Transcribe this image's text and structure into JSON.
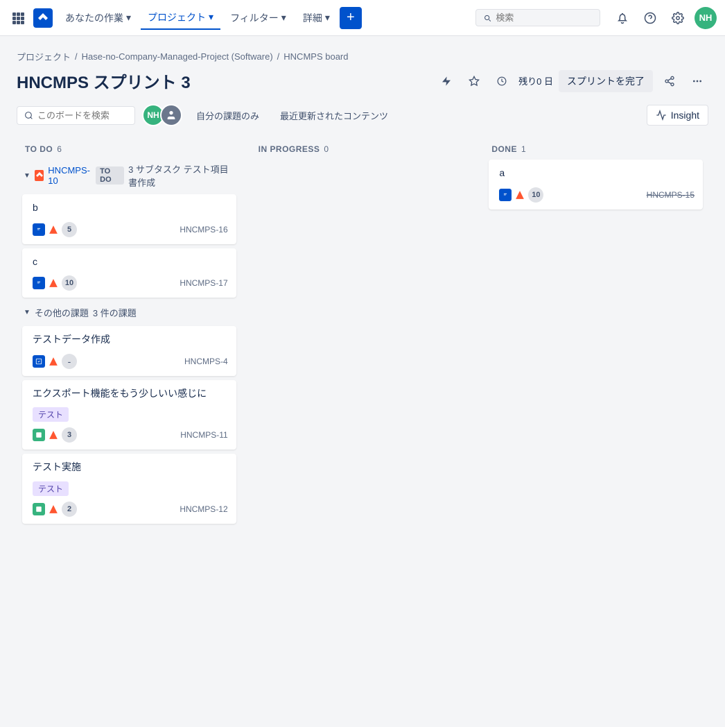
{
  "nav": {
    "apps_icon": "⊞",
    "logo": "J",
    "items": [
      {
        "label": "あなたの作業",
        "active": false
      },
      {
        "label": "プロジェクト",
        "active": true
      },
      {
        "label": "フィルター",
        "active": false
      },
      {
        "label": "詳細",
        "active": false
      }
    ],
    "add_btn": "+",
    "search_placeholder": "検索",
    "avatar_initials": "NH"
  },
  "breadcrumb": {
    "project": "プロジェクト",
    "managed": "Hase-no-Company-Managed-Project (Software)",
    "board": "HNCMPS board"
  },
  "header": {
    "title": "HNCMPS スプリント 3",
    "days_remaining_label": "残り0 日",
    "complete_sprint_label": "スプリントを完了",
    "insight_label": "Insight"
  },
  "toolbar": {
    "search_placeholder": "このボードを検索",
    "my_issues_label": "自分の課題のみ",
    "recent_label": "最近更新されたコンテンツ"
  },
  "columns": {
    "todo": {
      "title": "TO DO",
      "count": "6"
    },
    "in_progress": {
      "title": "IN PROGRESS",
      "count": "0"
    },
    "done": {
      "title": "DONE",
      "count": "1"
    }
  },
  "epic_group": {
    "chevron": "▼",
    "icon_label": "epic",
    "name": "HNCMPS-10",
    "todo_badge": "TO DO",
    "subtask_info": "3 サブタスク テスト項目書作成",
    "cards": [
      {
        "title": "b",
        "points": "5",
        "id": "HNCMPS-16",
        "done": false
      },
      {
        "title": "c",
        "points": "10",
        "id": "HNCMPS-17",
        "done": false
      }
    ]
  },
  "other_group": {
    "chevron": "▼",
    "label": "その他の課題",
    "count_label": "3 件の課題",
    "cards": [
      {
        "title": "テストデータ作成",
        "tag": null,
        "points": "-",
        "id": "HNCMPS-4",
        "done": false
      },
      {
        "title": "エクスポート機能をもう少しいい感じに",
        "tag": "テスト",
        "points": "3",
        "id": "HNCMPS-11",
        "done": false
      },
      {
        "title": "テスト実施",
        "tag": "テスト",
        "points": "2",
        "id": "HNCMPS-12",
        "done": false
      }
    ]
  },
  "done_column": {
    "cards": [
      {
        "title": "a",
        "points": "10",
        "id": "HNCMPS-15",
        "done": true
      }
    ]
  }
}
